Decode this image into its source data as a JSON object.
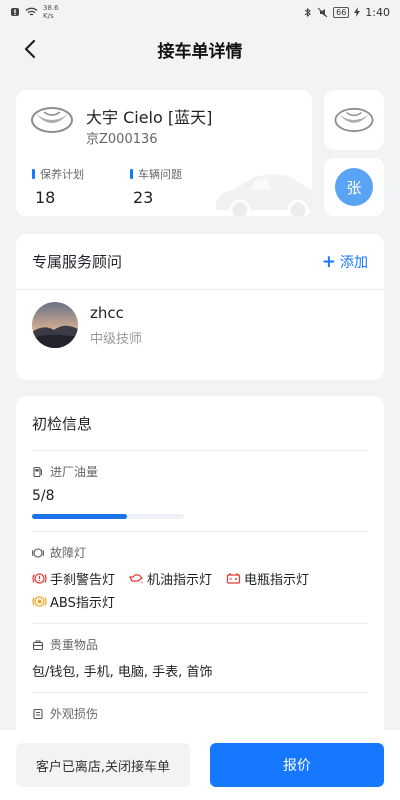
{
  "status_bar": {
    "net_speed": "38.6\nK/s",
    "battery": "66",
    "time": "1:40"
  },
  "header": {
    "title": "接车单详情"
  },
  "vehicle": {
    "name": "大宇 Cielo [蓝天]",
    "plate": "京Z000136",
    "stats": [
      {
        "label": "保养计划",
        "value": "18"
      },
      {
        "label": "车辆问题",
        "value": "23"
      }
    ],
    "side_avatar_text": "张"
  },
  "advisor": {
    "section_title": "专属服务顾问",
    "add_label": "添加",
    "name": "zhcc",
    "role": "中级技师"
  },
  "inspection": {
    "section_title": "初检信息",
    "fuel": {
      "label": "进厂油量",
      "value": "5/8",
      "fraction": 0.625
    },
    "fault_lights": {
      "label": "故障灯",
      "items": [
        {
          "label": "手刹警告灯",
          "color": "#e53935"
        },
        {
          "label": "机油指示灯",
          "color": "#e53935"
        },
        {
          "label": "电瓶指示灯",
          "color": "#e53935"
        },
        {
          "label": "ABS指示灯",
          "color": "#f5a623"
        }
      ]
    },
    "valuables": {
      "label": "贵重物品",
      "value": "包/钱包, 手机, 电脑, 手表, 首饰"
    },
    "exterior": {
      "label": "外观损伤"
    }
  },
  "actions": {
    "close_label": "客户已离店,关闭接车单",
    "quote_label": "报价"
  },
  "colors": {
    "accent": "#1677ff",
    "fault": "#e53935",
    "warning": "#f5a623"
  }
}
